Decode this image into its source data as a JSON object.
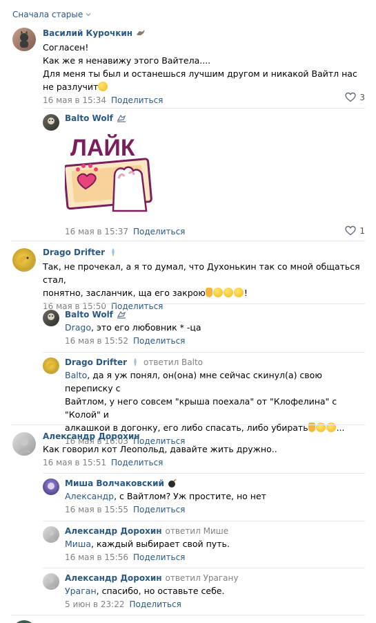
{
  "sort": {
    "label": "Сначала старые"
  },
  "share_label": "Поделиться",
  "comments": [
    {
      "author": "Василий Курочкин",
      "text": "Согласен!\nКак же я ненавижу этого Вайтела....\nДля меня ты был и останешься лучшим другом и никакой Вайтл нас не разлучит",
      "time": "16 мая в 15:34",
      "likes": "3"
    },
    {
      "author": "Balto Wolf",
      "sticker_text": "ЛАЙК",
      "time": "16 мая в 15:37",
      "likes": "1"
    },
    {
      "author": "Drago Drifter",
      "text": "Так, не прочекал, а я то думал, что Духонькин так со мной общаться стал,\nпонятно, засланчик, ща его закрою",
      "text_end": "!",
      "time": "16 мая в 15:50"
    },
    {
      "author": "Balto Wolf",
      "mention": "Drago",
      "text": ", это его любовник * -ца",
      "time": "16 мая в 15:52"
    },
    {
      "author": "Drago Drifter",
      "replied": "ответил Balto",
      "mention": "Balto",
      "text": ", да я уж понял, он(она) мне сейчас скинул(а) свою переписку с\nВайтлом, у него совсем \"крыша поехала\" от \"Клофелина\" с \"Колой\" и\nалкашкой в догонку, его либо спасать, либо убирать",
      "text_end": "...",
      "time": "16 мая в 16:03"
    },
    {
      "author": "Александр Дорохин",
      "text": "Как говорил кот Леопольд, давайте жить дружно..",
      "time": "16 мая в 15:51"
    },
    {
      "author": "Миша Волчаковский",
      "mention": "Александр",
      "text": ", с Вайтлом? Уж простите, но нет",
      "time": "16 мая в 15:55"
    },
    {
      "author": "Александр Дорохин",
      "replied": "ответил Мише",
      "mention": "Миша",
      "text": ", каждый выбирает свой путь.",
      "time": "16 мая в 15:56"
    },
    {
      "author": "Александр Дорохин",
      "replied": "ответил Урагану",
      "mention": "Ураган",
      "text": ", спасибо, но оставьте себе.",
      "time": "5 июн в 23:22"
    }
  ],
  "colors": {
    "link": "#2a5885",
    "meta": "#828282",
    "divider": "#e7e8ec",
    "sticker_text": "#7a1f5c",
    "sticker_heart": "#e8437a"
  }
}
